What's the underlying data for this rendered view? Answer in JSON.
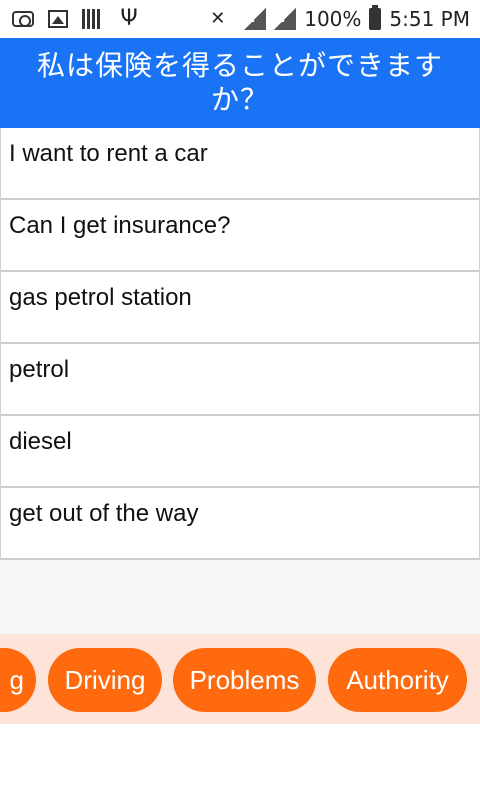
{
  "status_bar": {
    "battery": "100%",
    "time": "5:51 PM",
    "sim1": "?",
    "sim2": "?",
    "icons": [
      "camera-icon",
      "image-icon",
      "barcode-icon",
      "usb-icon",
      "mute-icon",
      "signal-icon",
      "signal-icon",
      "battery-icon"
    ]
  },
  "header": {
    "title": "私は保険を得ることができますか？"
  },
  "phrases": [
    "I want to rent a car",
    "Can I get insurance?",
    "gas petrol station",
    "petrol",
    "diesel",
    "get out of the way"
  ],
  "categories": {
    "partial": "g",
    "items": [
      "Driving",
      "Problems",
      "Authority"
    ]
  },
  "colors": {
    "header_bg": "#1a73f5",
    "chip_bg": "#ff6a0e",
    "catbar_bg": "#fde3d8"
  }
}
